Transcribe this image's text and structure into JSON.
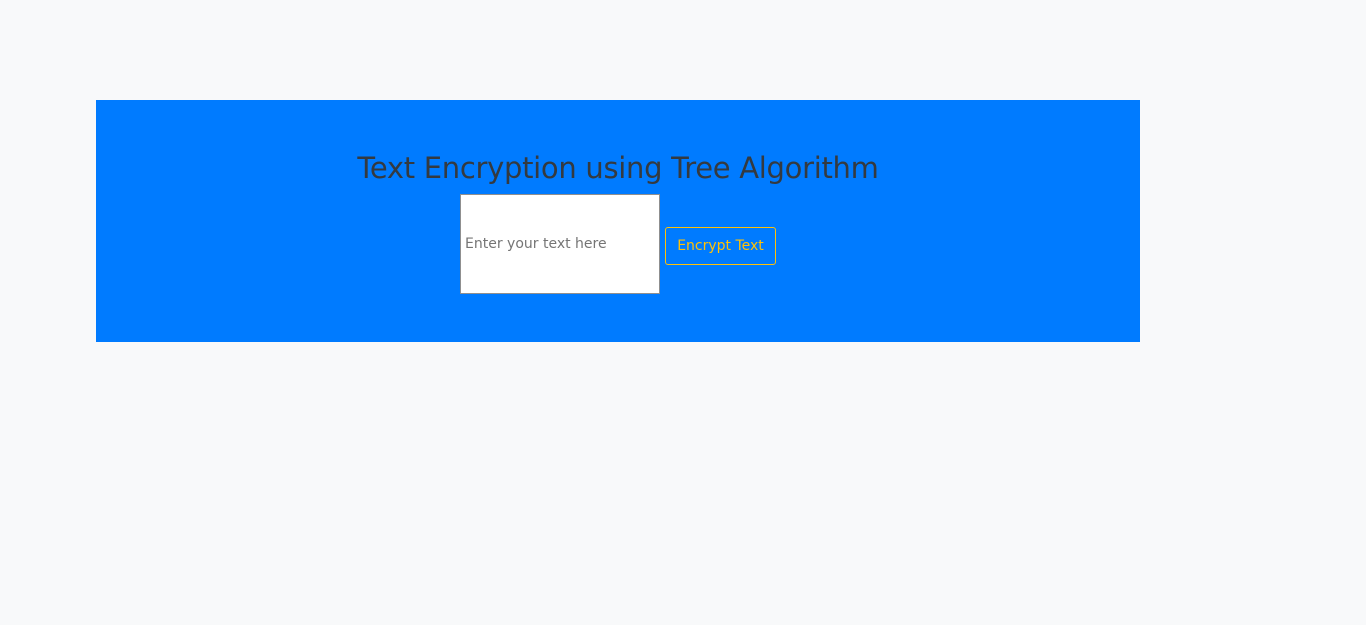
{
  "hero": {
    "title": "Text Encryption using Tree Algorithm"
  },
  "form": {
    "input_placeholder": "Enter your text here",
    "input_value": "",
    "encrypt_label": "Encrypt Text"
  },
  "colors": {
    "page_background": "#f8f9fa",
    "hero_background": "#007bff",
    "title_text": "#343a40",
    "button_accent": "#ffc107"
  }
}
